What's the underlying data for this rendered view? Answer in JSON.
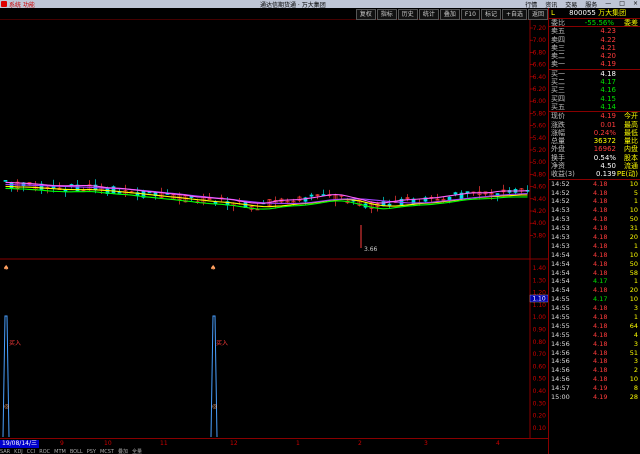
{
  "title_bar": {
    "menu": "系统 功能",
    "title": "通达信期货通 · 万大集团",
    "right_items": [
      "行情",
      "资讯",
      "交易",
      "服务",
      "—",
      "□",
      "×"
    ]
  },
  "toolbar": {
    "buttons": [
      "复权",
      "指标",
      "历史",
      "统计",
      "叠加",
      "F10",
      "标记",
      "+自选",
      "返回"
    ]
  },
  "chart": {
    "price_labels": [
      "7.20",
      "7.00",
      "6.80",
      "6.60",
      "6.40",
      "6.20",
      "6.00",
      "5.80",
      "5.60",
      "5.40",
      "5.20",
      "5.00",
      "4.80",
      "4.60",
      "4.40",
      "4.20",
      "4.00",
      "3.80"
    ],
    "low_marker": "3.66",
    "ind_labels": [
      "1.40",
      "1.30",
      "1.20",
      "1.10",
      "1.00",
      "0.90",
      "0.80",
      "0.70",
      "0.60",
      "0.50",
      "0.40",
      "0.30",
      "0.20",
      "0.10"
    ],
    "ind_current": "1.10",
    "signal_label": "买入",
    "signal_label2": "买入"
  },
  "time_axis": {
    "date_box": "19/08/14/三",
    "ticks": [
      "9",
      "10",
      "11",
      "12",
      "1",
      "2",
      "3",
      "4"
    ]
  },
  "bottom_tabs": [
    "SAR",
    "KDJ",
    "CCI",
    "ROC",
    "MTM",
    "BOLL",
    "PSY",
    "MCST",
    "叠加",
    "全量"
  ],
  "quote": {
    "header_letter": "L",
    "code": "800055",
    "name": "万大集团",
    "ratio_label": "委比",
    "ratio_val": "-55.56%",
    "diff_label": "委差",
    "asks": [
      {
        "label": "卖五",
        "price": "4.23"
      },
      {
        "label": "卖四",
        "price": "4.22"
      },
      {
        "label": "卖三",
        "price": "4.21"
      },
      {
        "label": "卖二",
        "price": "4.20"
      },
      {
        "label": "卖一",
        "price": "4.19"
      }
    ],
    "bids": [
      {
        "label": "买一",
        "price": "4.18"
      },
      {
        "label": "买二",
        "price": "4.17"
      },
      {
        "label": "买三",
        "price": "4.16"
      },
      {
        "label": "买四",
        "price": "4.15"
      },
      {
        "label": "买五",
        "price": "4.14"
      }
    ],
    "stats": [
      {
        "label": "现价",
        "val": "4.19",
        "extra": "今开"
      },
      {
        "label": "涨跌",
        "val": "0.01",
        "extra": "最高"
      },
      {
        "label": "涨幅",
        "val": "0.24%",
        "extra": "最低"
      },
      {
        "label": "总量",
        "val": "36372",
        "extra": "量比"
      },
      {
        "label": "外盘",
        "val": "16962",
        "extra": "内盘"
      },
      {
        "label": "换手",
        "val": "0.54%",
        "extra": "股本"
      },
      {
        "label": "净资",
        "val": "4.50",
        "extra": "流通"
      },
      {
        "label": "收益(3)",
        "val": "0.139",
        "extra": "PE(动)"
      }
    ],
    "ticks": [
      {
        "t": "14:52",
        "p": "4.18",
        "v": "10"
      },
      {
        "t": "14:52",
        "p": "4.18",
        "v": "5"
      },
      {
        "t": "14:52",
        "p": "4.18",
        "v": "1"
      },
      {
        "t": "14:53",
        "p": "4.18",
        "v": "10"
      },
      {
        "t": "14:53",
        "p": "4.18",
        "v": "50"
      },
      {
        "t": "14:53",
        "p": "4.18",
        "v": "31"
      },
      {
        "t": "14:53",
        "p": "4.18",
        "v": "20"
      },
      {
        "t": "14:53",
        "p": "4.18",
        "v": "1"
      },
      {
        "t": "14:54",
        "p": "4.18",
        "v": "10"
      },
      {
        "t": "14:54",
        "p": "4.18",
        "v": "50"
      },
      {
        "t": "14:54",
        "p": "4.18",
        "v": "58"
      },
      {
        "t": "14:54",
        "p": "4.17",
        "v": "1"
      },
      {
        "t": "14:54",
        "p": "4.18",
        "v": "20"
      },
      {
        "t": "14:55",
        "p": "4.17",
        "v": "10"
      },
      {
        "t": "14:55",
        "p": "4.18",
        "v": "3"
      },
      {
        "t": "14:55",
        "p": "4.18",
        "v": "1"
      },
      {
        "t": "14:55",
        "p": "4.18",
        "v": "64"
      },
      {
        "t": "14:55",
        "p": "4.18",
        "v": "4"
      },
      {
        "t": "14:56",
        "p": "4.18",
        "v": "3"
      },
      {
        "t": "14:56",
        "p": "4.18",
        "v": "51"
      },
      {
        "t": "14:56",
        "p": "4.18",
        "v": "3"
      },
      {
        "t": "14:56",
        "p": "4.18",
        "v": "2"
      },
      {
        "t": "14:56",
        "p": "4.18",
        "v": "10"
      },
      {
        "t": "14:57",
        "p": "4.19",
        "v": "8"
      },
      {
        "t": "15:00",
        "p": "4.19",
        "v": "28"
      }
    ],
    "tick_colors": [
      "red",
      "red",
      "red",
      "red",
      "red",
      "red",
      "red",
      "red",
      "red",
      "red",
      "red",
      "green",
      "red",
      "green",
      "red",
      "red",
      "red",
      "red",
      "red",
      "red",
      "red",
      "red",
      "red",
      "red",
      "red"
    ]
  }
}
